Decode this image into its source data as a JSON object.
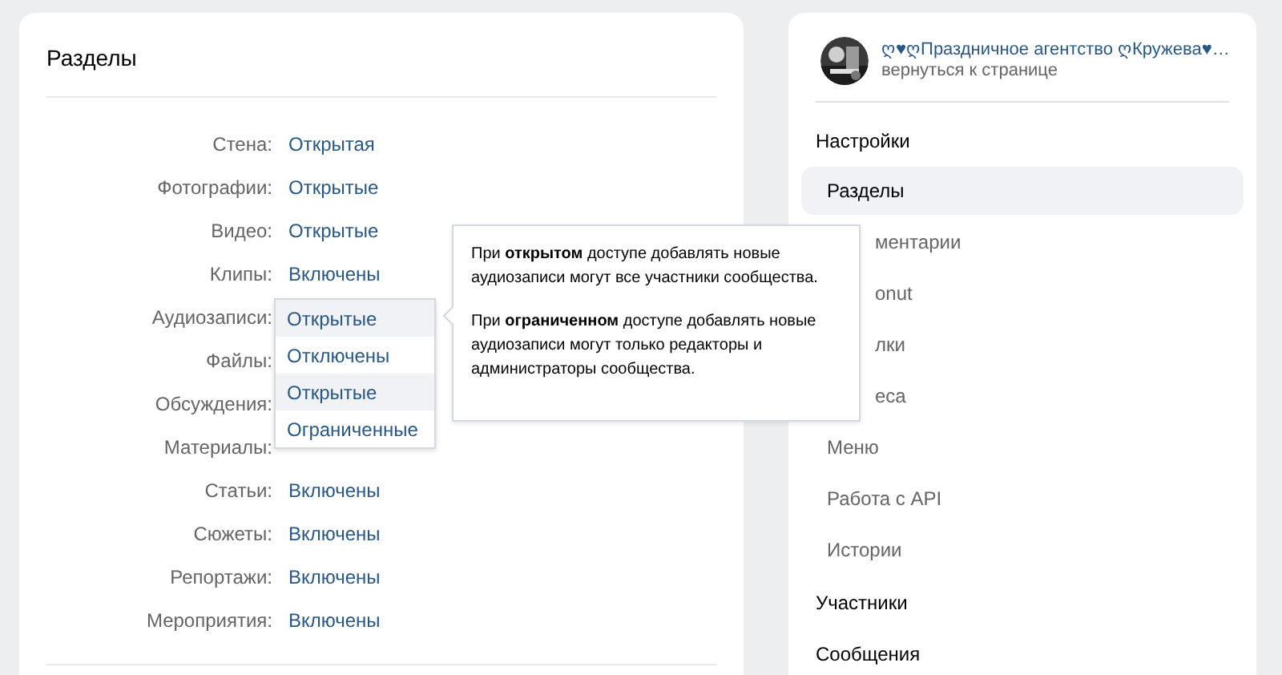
{
  "sections_panel": {
    "title": "Разделы",
    "rows": [
      {
        "label": "Стена:",
        "value": "Открытая"
      },
      {
        "label": "Фотографии:",
        "value": "Открытые"
      },
      {
        "label": "Видео:",
        "value": "Открытые"
      },
      {
        "label": "Клипы:",
        "value": "Включены"
      },
      {
        "label": "Аудиозаписи:"
      },
      {
        "label": "Файлы:"
      },
      {
        "label": "Обсуждения:"
      },
      {
        "label": "Материалы:"
      },
      {
        "label": "Статьи:",
        "value": "Включены"
      },
      {
        "label": "Сюжеты:",
        "value": "Включены"
      },
      {
        "label": "Репортажи:",
        "value": "Включены"
      },
      {
        "label": "Мероприятия:",
        "value": "Включены"
      }
    ]
  },
  "dropdown": {
    "options": [
      {
        "label": "Открытые",
        "highlighted": true
      },
      {
        "label": "Отключены",
        "highlighted": false
      },
      {
        "label": "Открытые",
        "highlighted": true
      },
      {
        "label": "Ограниченные",
        "highlighted": false
      }
    ]
  },
  "tooltip": {
    "paragraphs": [
      "При **открытом** доступе добавлять новые аудиозаписи могут все участники сообщества.",
      "При **ограниченном** доступе добавлять новые аудиозаписи могут только редакторы и администраторы сообщества."
    ]
  },
  "sidebar": {
    "community": {
      "name": "ღ♥ღПраздничное агентство ღКружева♥…",
      "link": "вернуться к странице"
    },
    "groups": [
      {
        "title": "Настройки",
        "items": [
          {
            "label": "Разделы",
            "selected": true,
            "covered": false
          },
          {
            "label": "ментарии",
            "selected": false,
            "covered": true
          },
          {
            "label": "onut",
            "selected": false,
            "covered": true
          },
          {
            "label": "лки",
            "selected": false,
            "covered": true
          },
          {
            "label": "еса",
            "selected": false,
            "covered": true
          },
          {
            "label": "Меню",
            "selected": false,
            "covered": false
          },
          {
            "label": "Работа с API",
            "selected": false,
            "covered": false
          },
          {
            "label": "Истории",
            "selected": false,
            "covered": false
          }
        ]
      },
      {
        "title": "Участники"
      },
      {
        "title": "Сообщения"
      }
    ]
  }
}
